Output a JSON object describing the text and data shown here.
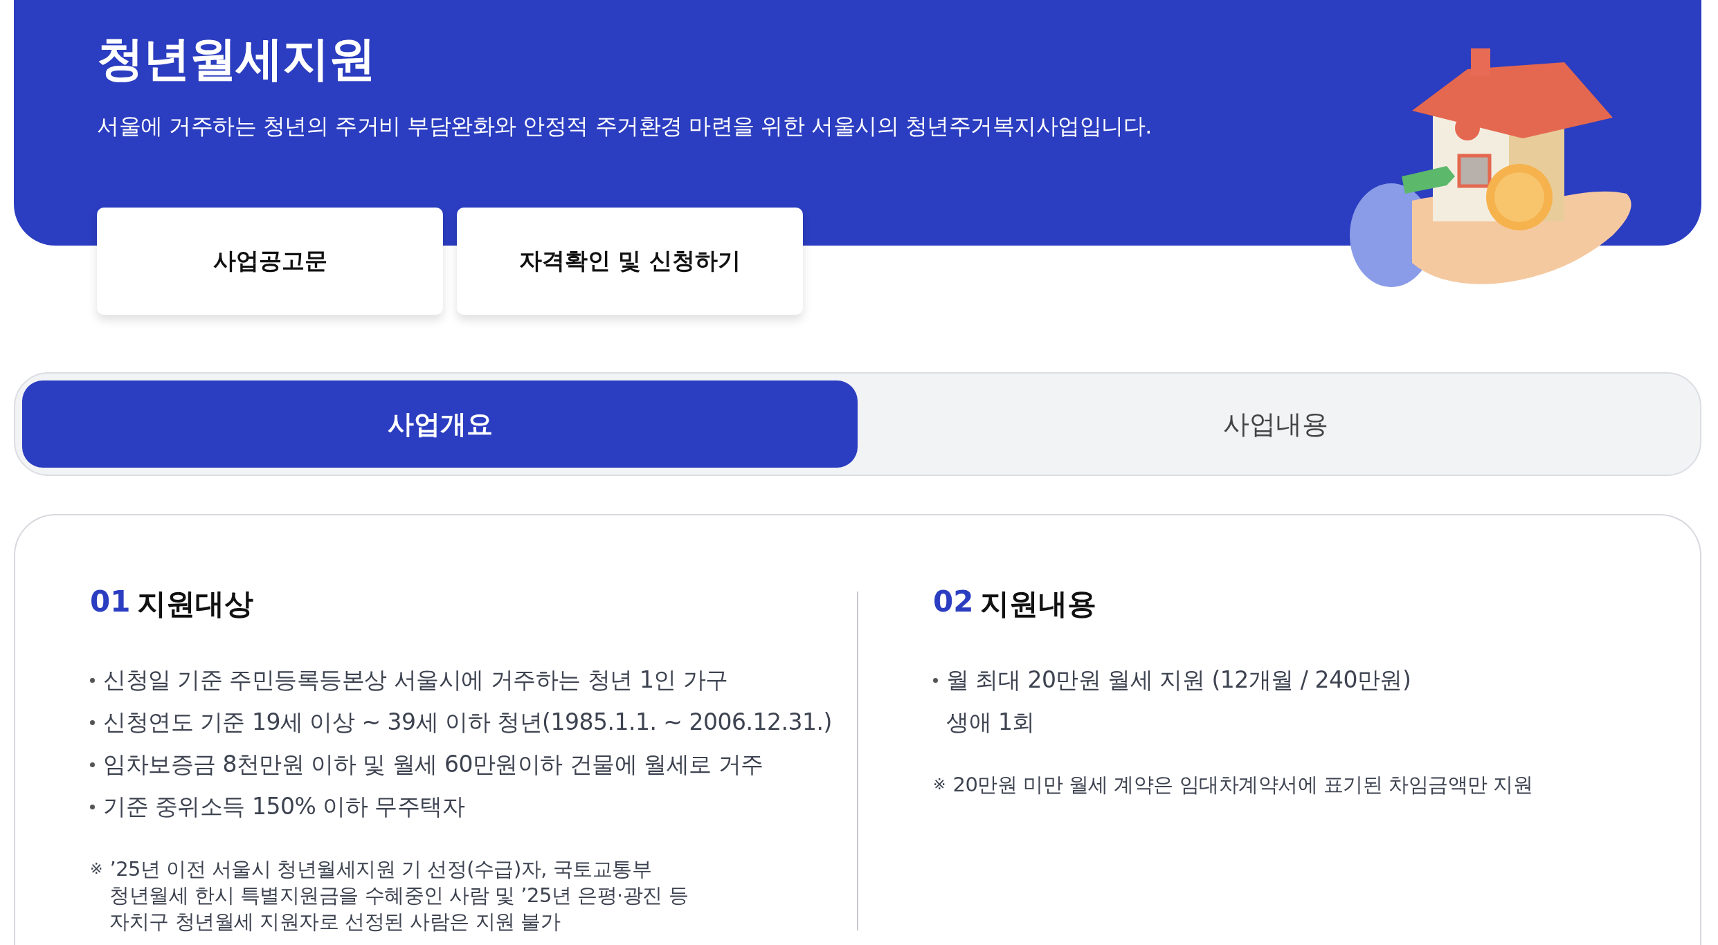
{
  "header": {
    "title": "청년월세지원",
    "subtitle": "서울에 거주하는 청년의 주거비 부담완화와 안정적 주거환경 마련을 위한 서울시의 청년주거복지사업입니다."
  },
  "buttons": [
    "사업공고문",
    "자격확인 및 신청하기"
  ],
  "tabs": [
    {
      "label": "사업개요",
      "selected": true
    },
    {
      "label": "사업내용",
      "selected": false
    }
  ],
  "sections": [
    {
      "number": "01",
      "title": "지원대상",
      "bullets": [
        {
          "lines": [
            "신청일 기준 주민등록등본상 서울시에 거주하는 청년 1인 가구"
          ]
        },
        {
          "lines": [
            "신청연도 기준 19세 이상 ~ 39세 이하 청년(1985.1.1. ~ 2006.12.31.)"
          ]
        },
        {
          "lines": [
            "임차보증금 8천만원 이하 및 월세 60만원이하 건물에 월세로 거주"
          ]
        },
        {
          "lines": [
            "기준 중위소득 150% 이하 무주택자"
          ]
        }
      ],
      "note": {
        "mark": "※",
        "lines": [
          "’25년 이전 서울시 청년월세지원 기 선정(수급)자, 국토교통부",
          "청년월세 한시 특별지원금을 수혜중인 사람 및 ’25년 은평·광진 등",
          "자치구 청년월세 지원자로 선정된 사람은 지원 불가"
        ]
      }
    },
    {
      "number": "02",
      "title": "지원내용",
      "bullets": [
        {
          "lines": [
            "월 최대 20만원 월세 지원 (12개월 / 240만원)",
            "생애 1회"
          ]
        }
      ],
      "note": {
        "mark": "※",
        "lines": [
          "20만원 미만 월세 계약은 임대차계약서에 표기된 차임금액만 지원"
        ]
      }
    }
  ]
}
